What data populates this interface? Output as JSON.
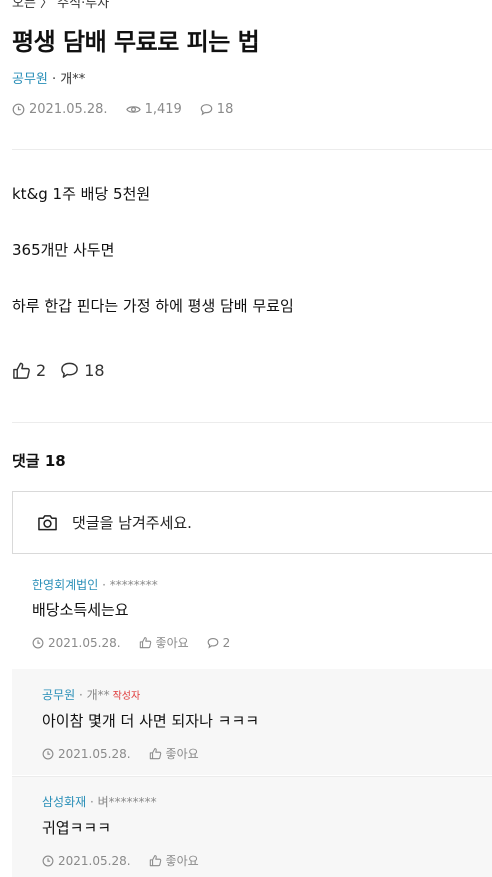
{
  "breadcrumb": "오픈 〉 주식·투자",
  "post": {
    "title": "평생 담배 무료로 피는 법",
    "company": "공무원",
    "author": "· 개**",
    "date": "2021.05.28.",
    "views": "1,419",
    "comment_count": "18",
    "body": [
      "kt&g 1주 배당 5천원",
      "365개만 사두면",
      "하루 한갑 핀다는 가정 하에 평생 담배 무료임"
    ],
    "likes": "2",
    "comments": "18"
  },
  "comments_section": {
    "header": "댓글 18",
    "input_placeholder": "댓글을 남겨주세요."
  },
  "comments": [
    {
      "company": "한영회계법인",
      "author": " · ********",
      "text": "배당소득세는요",
      "date": "2021.05.28.",
      "like_label": "좋아요",
      "reply_count": "2"
    },
    {
      "company": "공무원",
      "author": " · 개**",
      "badge": "작성자",
      "text": "아이참 몇개 더 사면 되자나 ㅋㅋㅋ",
      "date": "2021.05.28.",
      "like_label": "좋아요"
    },
    {
      "company": "삼성화재",
      "author": " · 벼********",
      "text": "귀엽ㅋㅋㅋ",
      "date": "2021.05.28.",
      "like_label": "좋아요"
    }
  ]
}
